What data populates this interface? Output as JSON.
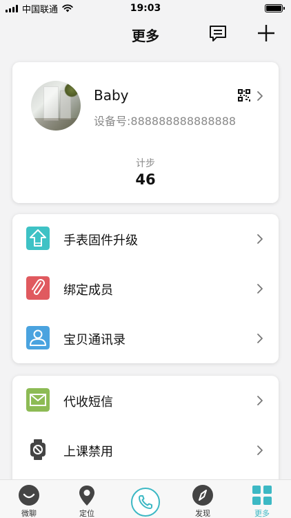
{
  "status_bar": {
    "carrier": "中国联通",
    "time": "19:03"
  },
  "header": {
    "title": "更多",
    "icons": [
      "message-icon",
      "plus-icon"
    ]
  },
  "profile": {
    "name": "Baby",
    "device_label": "设备号:888888888888888",
    "steps_label": "计步",
    "steps_value": "46",
    "icons": [
      "qr-code-icon",
      "chevron-right-icon"
    ]
  },
  "menu_group_1": [
    {
      "label": "手表固件升级",
      "icon": "firmware-upgrade-icon",
      "color": "#3ec2c5"
    },
    {
      "label": "绑定成员",
      "icon": "paperclip-icon",
      "color": "#e05a5f"
    },
    {
      "label": "宝贝通讯录",
      "icon": "contact-icon",
      "color": "#4aa3df"
    }
  ],
  "menu_group_2": [
    {
      "label": "代收短信",
      "icon": "envelope-icon",
      "color": "#8dbb55"
    },
    {
      "label": "上课禁用",
      "icon": "watch-disabled-icon",
      "color": "#444444"
    }
  ],
  "tab_bar": {
    "tabs": [
      {
        "label": "微聊",
        "icon": "chat-face-icon"
      },
      {
        "label": "定位",
        "icon": "location-pin-icon"
      },
      {
        "label": "发现",
        "icon": "compass-icon"
      },
      {
        "label": "更多",
        "icon": "grid-icon",
        "active": true
      }
    ],
    "center_icon": "phone-icon",
    "accent_color": "#3cb8c4"
  }
}
